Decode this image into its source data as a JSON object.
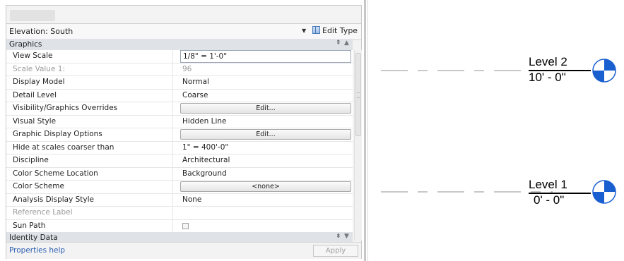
{
  "panel": {
    "type_selector": "Elevation: South",
    "edit_type_label": "Edit Type",
    "group_graphics": "Graphics",
    "group_identity": "Identity Data",
    "properties": [
      {
        "name": "View Scale",
        "value": "1/8\" = 1'-0\"",
        "kind": "input",
        "disabled": false
      },
      {
        "name": "Scale Value    1:",
        "value": "96",
        "kind": "text",
        "disabled": true
      },
      {
        "name": "Display Model",
        "value": "Normal",
        "kind": "text",
        "disabled": false
      },
      {
        "name": "Detail Level",
        "value": "Coarse",
        "kind": "text",
        "disabled": false
      },
      {
        "name": "Visibility/Graphics Overrides",
        "value": "Edit...",
        "kind": "button",
        "disabled": false
      },
      {
        "name": "Visual Style",
        "value": "Hidden Line",
        "kind": "text",
        "disabled": false
      },
      {
        "name": "Graphic Display Options",
        "value": "Edit...",
        "kind": "button",
        "disabled": false
      },
      {
        "name": "Hide at scales coarser than",
        "value": "1\" = 400'-0\"",
        "kind": "text",
        "disabled": false
      },
      {
        "name": "Discipline",
        "value": "Architectural",
        "kind": "text",
        "disabled": false
      },
      {
        "name": "Color Scheme Location",
        "value": "Background",
        "kind": "text",
        "disabled": false
      },
      {
        "name": "Color Scheme",
        "value": "<none>",
        "kind": "button",
        "disabled": false
      },
      {
        "name": "Analysis Display Style",
        "value": "None",
        "kind": "text",
        "disabled": false
      },
      {
        "name": "Reference Label",
        "value": "",
        "kind": "text",
        "disabled": true
      },
      {
        "name": "Sun Path",
        "value": "",
        "kind": "checkbox",
        "disabled": false
      }
    ],
    "help_link": "Properties help",
    "apply_label": "Apply"
  },
  "levels": [
    {
      "name": "Level 2",
      "elevation": "10' - 0\""
    },
    {
      "name": "Level 1",
      "elevation": "0' - 0\""
    }
  ],
  "colors": {
    "level_line": "#a8a8a8",
    "level_head_blue": "#1a5fd0",
    "link": "#2a5db0"
  }
}
